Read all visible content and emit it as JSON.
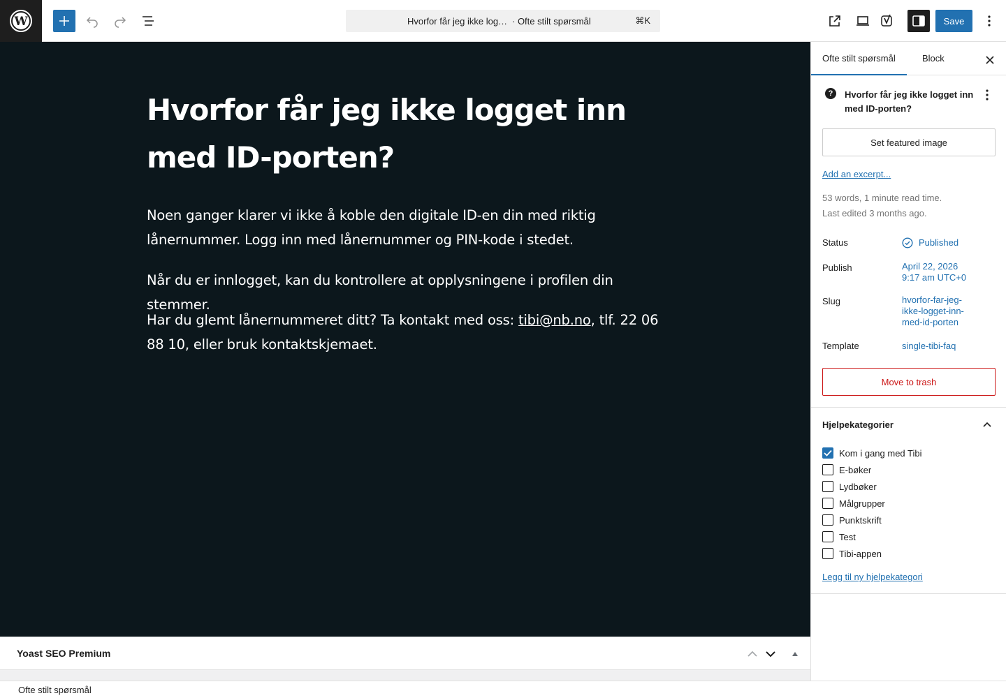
{
  "toolbar": {
    "command_title": "Hvorfor får jeg ikke log…",
    "command_type": "· Ofte stilt spørsmål",
    "command_shortcut": "⌘K",
    "save_label": "Save"
  },
  "post": {
    "title": "Hvorfor får jeg ikke logget inn med ID-porten?",
    "paragraph1": "Noen ganger klarer vi ikke å koble den digitale ID-en din med riktig lånernummer. Logg inn med lånernummer og PIN-kode i stedet.",
    "paragraph2": "Når du er innlogget, kan du kontrollere at opplysningene i profilen din stemmer.",
    "paragraph3_before": "Har du glemt lånernummeret ditt? Ta kontakt med oss: ",
    "paragraph3_link": "tibi@nb.no",
    "paragraph3_after": ", tlf. 22 06 88 10, eller bruk kontaktskjemaet."
  },
  "yoast": {
    "title": "Yoast SEO Premium"
  },
  "footer": {
    "breadcrumb": "Ofte stilt spørsmål"
  },
  "sidebar": {
    "tab_document": "Ofte stilt spørsmål",
    "tab_block": "Block",
    "doc_title": "Hvorfor får jeg ikke logget inn med ID-porten?",
    "featured_image_label": "Set featured image",
    "excerpt_label": "Add an excerpt...",
    "word_count": "53 words, 1 minute read time.",
    "last_edited": "Last edited 3 months ago.",
    "status_label": "Status",
    "status_value": "Published",
    "publish_label": "Publish",
    "publish_date": "April 22, 2026",
    "publish_time": "9:17 am UTC+0",
    "slug_label": "Slug",
    "slug_value": "hvorfor-far-jeg-ikke-logget-inn-med-id-porten",
    "template_label": "Template",
    "template_value": "single-tibi-faq",
    "trash_label": "Move to trash",
    "categories_heading": "Hjelpekategorier",
    "categories": [
      {
        "label": "Kom i gang med Tibi",
        "checked": true
      },
      {
        "label": "E-bøker",
        "checked": false
      },
      {
        "label": "Lydbøker",
        "checked": false
      },
      {
        "label": "Målgrupper",
        "checked": false
      },
      {
        "label": "Punktskrift",
        "checked": false
      },
      {
        "label": "Test",
        "checked": false
      },
      {
        "label": "Tibi-appen",
        "checked": false
      }
    ],
    "add_category_label": "Legg til ny hjelpekategori"
  },
  "colors": {
    "accent": "#2271b1",
    "canvas_bg": "#0c171c",
    "danger": "#cc1818"
  }
}
